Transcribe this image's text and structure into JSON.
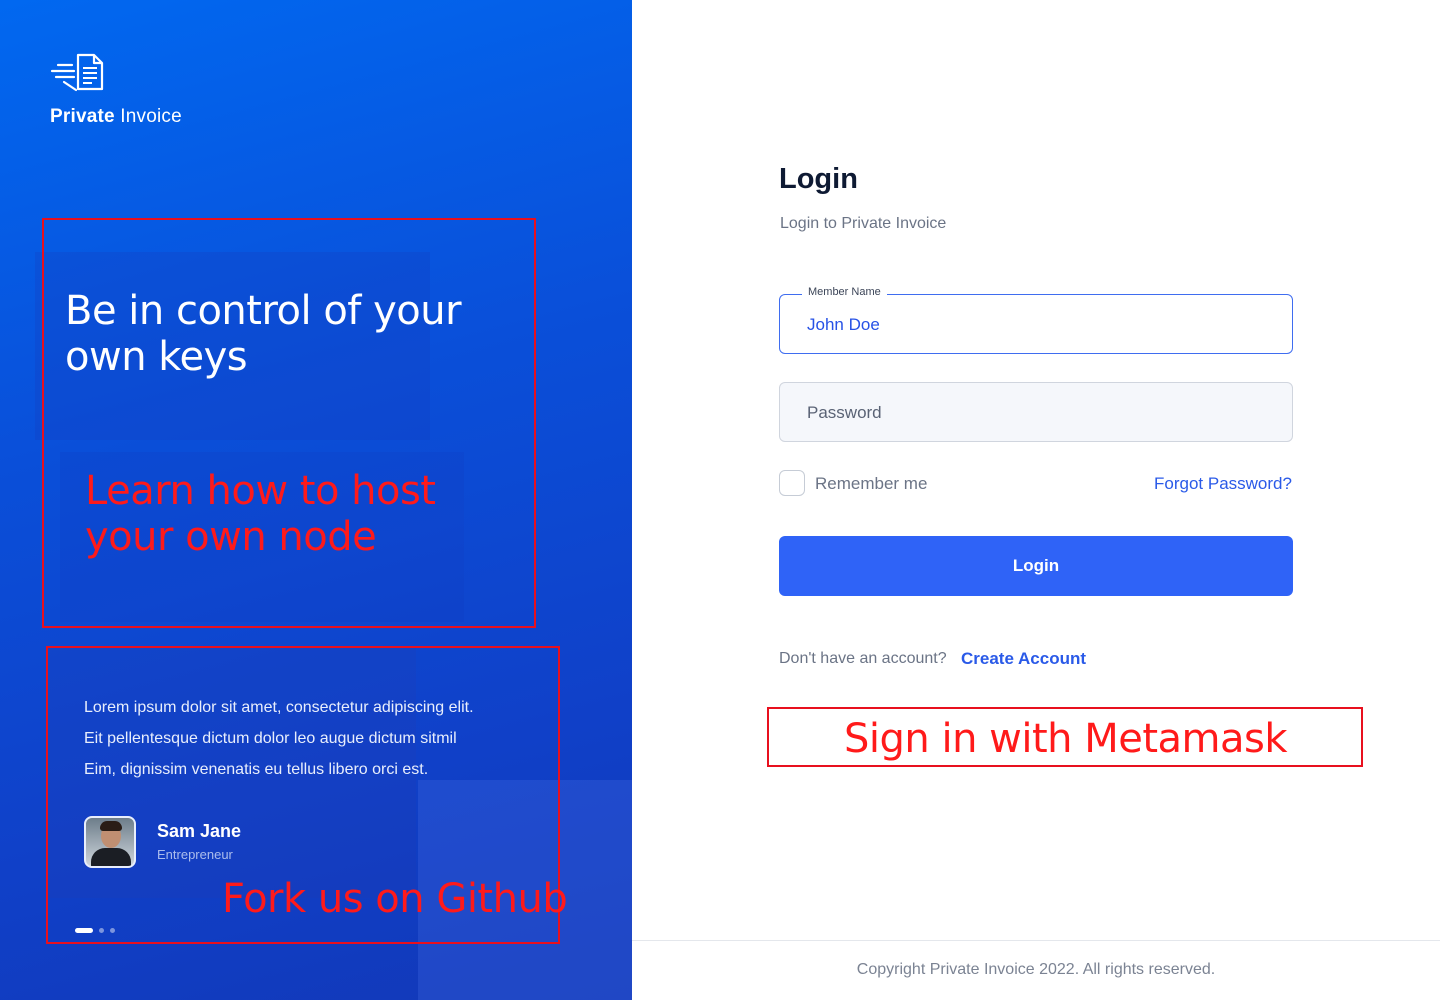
{
  "brand": {
    "bold": "Private",
    "light": "Invoice",
    "logo_icon": "invoice-document-icon"
  },
  "hero": {
    "headline": "Be in control of your own keys"
  },
  "annotations": {
    "host_node": "Learn how to host your own node",
    "github": "Fork us on Github",
    "metamask": "Sign in with Metamask",
    "color": "#ff1a1a"
  },
  "testimonial": {
    "quote_lines": [
      "Lorem ipsum dolor sit amet, consectetur adipiscing elit.",
      "Eit pellentesque dictum dolor leo augue dictum sitmil",
      "Eim, dignissim venenatis eu tellus libero orci est."
    ],
    "name": "Sam Jane",
    "role": "Entrepreneur",
    "carousel": {
      "total": 3,
      "active": 1
    }
  },
  "login": {
    "title": "Login",
    "subtitle": "Login to Private Invoice",
    "member_label": "Member Name",
    "member_value": "John Doe",
    "password_placeholder": "Password",
    "remember": "Remember me",
    "remember_checked": false,
    "forgot": "Forgot Password?",
    "submit": "Login",
    "no_account": "Don't have an account?",
    "create": "Create Account"
  },
  "footer": {
    "copyright": "Copyright Private Invoice 2022. All rights reserved."
  },
  "colors": {
    "accent": "#2f63f7",
    "link": "#2a5ae8",
    "panel": "#0a4fd9",
    "annotation_border": "#e8101e"
  }
}
